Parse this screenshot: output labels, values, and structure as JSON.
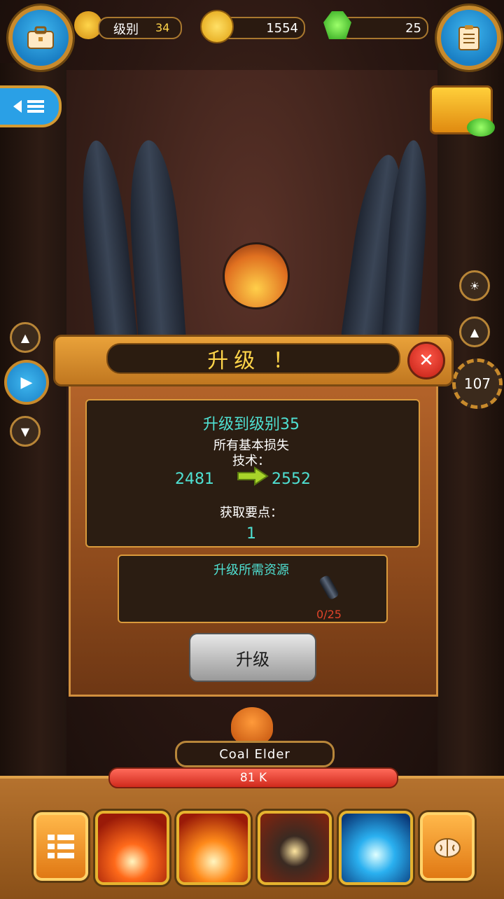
{
  "top_bar": {
    "level_label": "级别",
    "level_value": "34",
    "gold": "1554",
    "gems": "25"
  },
  "right_side": {
    "counter": "107"
  },
  "dialog": {
    "title": "升级 ！",
    "upgrade_to": "升级到级别35",
    "stat_label_line1": "所有基本损失",
    "stat_label_line2": "技术：",
    "stat_old": "2481",
    "stat_new": "2552",
    "points_label": "获取要点：",
    "points_value": "1",
    "resources_label": "升级所需资源",
    "resource_count": "0/25",
    "upgrade_button": "升级"
  },
  "boss": {
    "name": "Coal Elder",
    "hp": "81 K"
  },
  "colors": {
    "accent_orange": "#e9a23a",
    "teal_text": "#4fe0d2",
    "hp_red": "#d02a1c",
    "button_blue": "#2aa0e6"
  }
}
